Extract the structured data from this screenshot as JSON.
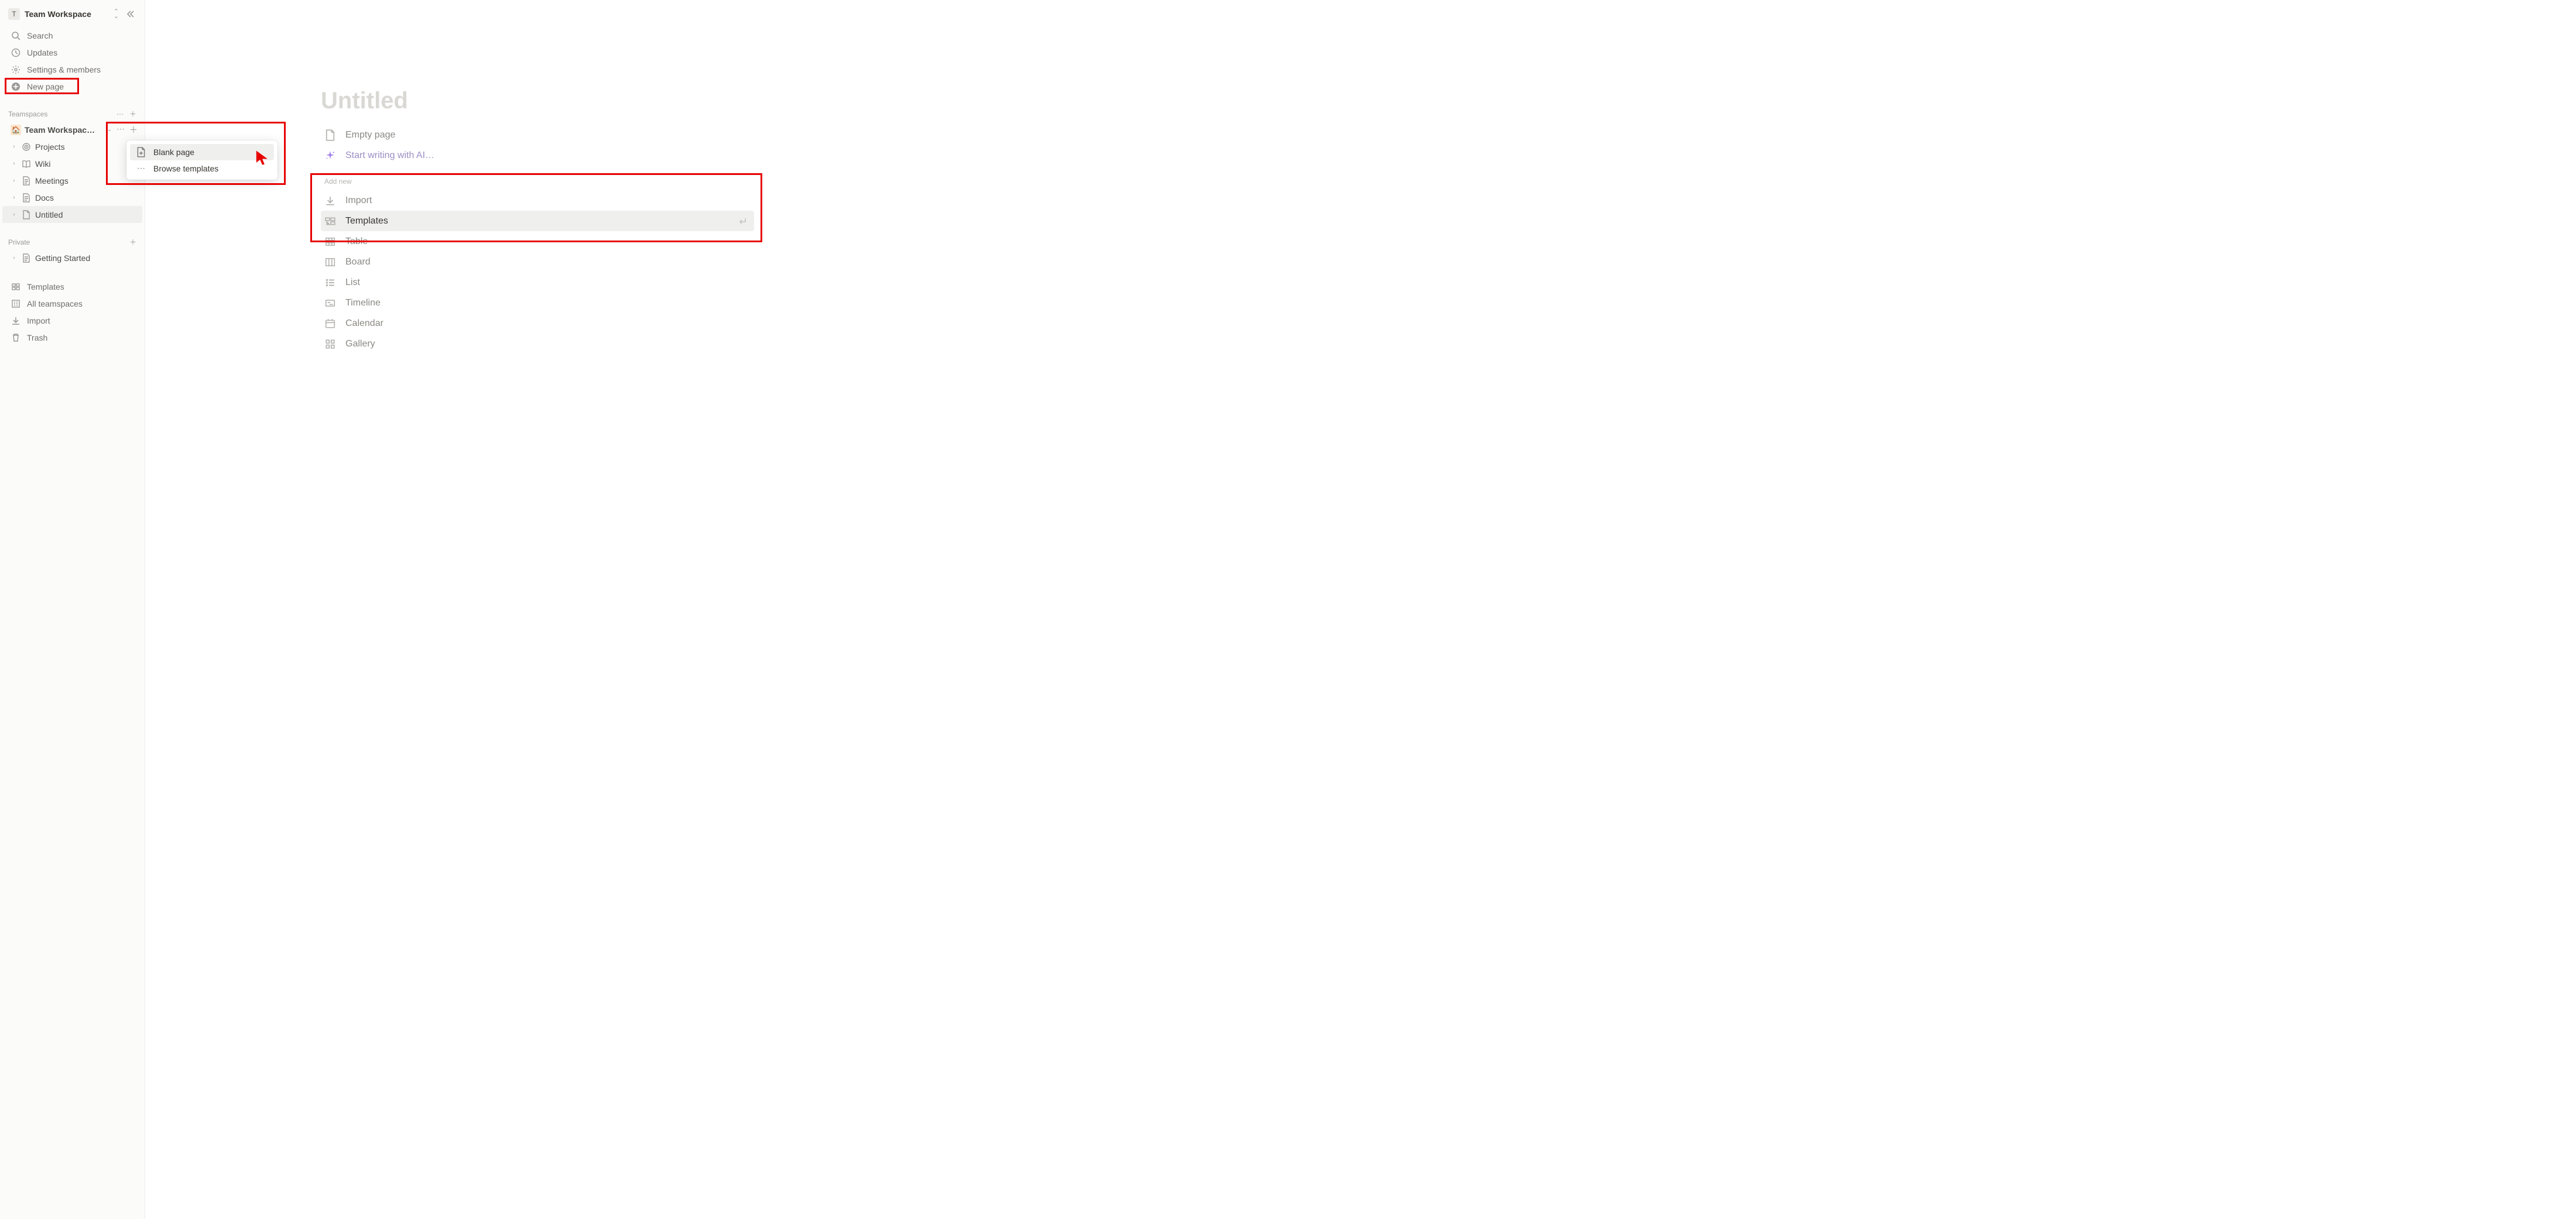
{
  "workspace": {
    "letter": "T",
    "name": "Team Workspace"
  },
  "sidebar": {
    "search": "Search",
    "updates": "Updates",
    "settings": "Settings & members",
    "new_page": "New page",
    "teamspaces_header": "Teamspaces",
    "team_workspace": "Team Workspac…",
    "projects": "Projects",
    "wiki": "Wiki",
    "meetings": "Meetings",
    "docs": "Docs",
    "untitled": "Untitled",
    "private_header": "Private",
    "getting_started": "Getting Started",
    "templates": "Templates",
    "all_teamspaces": "All teamspaces",
    "import": "Import",
    "trash": "Trash"
  },
  "context_menu": {
    "blank_page": "Blank page",
    "browse_templates": "Browse templates"
  },
  "page": {
    "title": "Untitled",
    "empty_page": "Empty page",
    "start_ai": "Start writing with AI…",
    "add_new_header": "Add new",
    "import": "Import",
    "templates": "Templates",
    "table": "Table",
    "board": "Board",
    "list": "List",
    "timeline": "Timeline",
    "calendar": "Calendar",
    "gallery": "Gallery"
  }
}
